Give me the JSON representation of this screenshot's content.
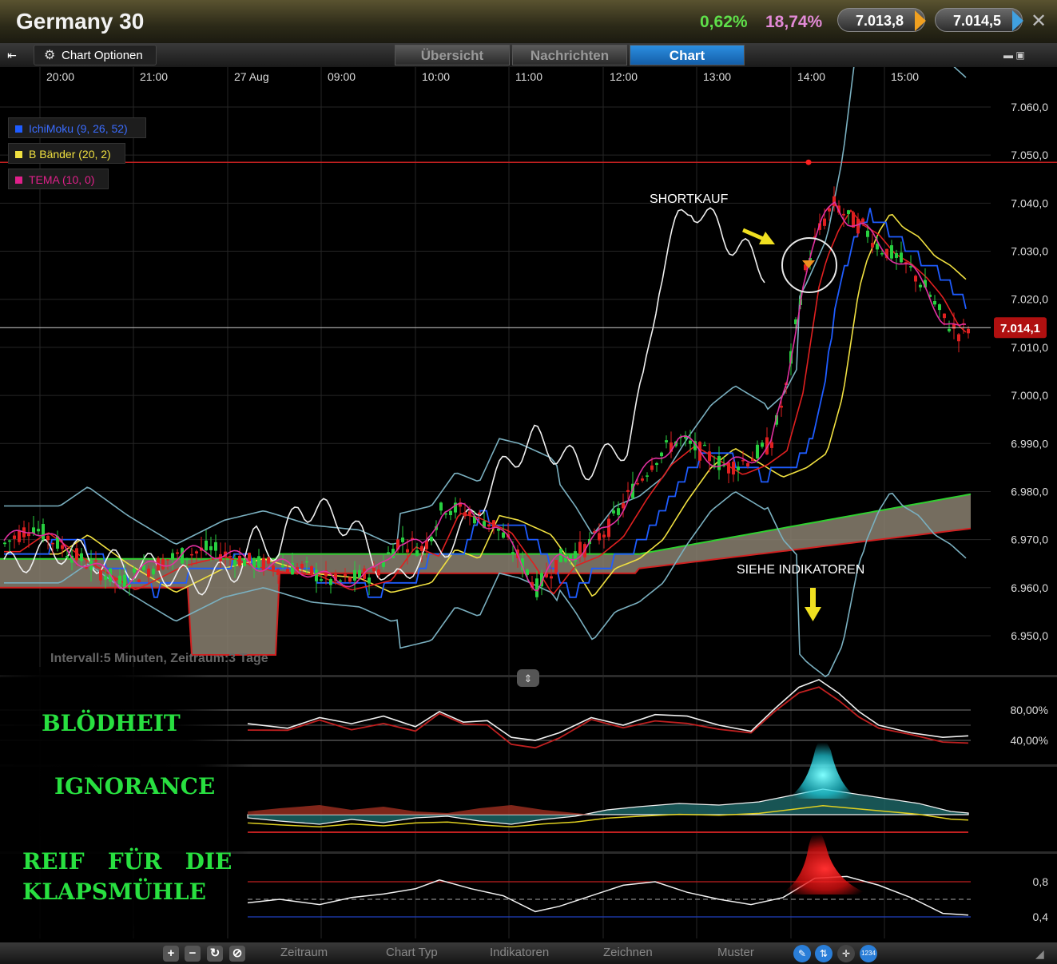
{
  "header": {
    "title": "Germany 30",
    "change_pct": "0,62%",
    "range_pct": "18,74%",
    "sell": "7.013,8",
    "buy": "7.014,5"
  },
  "toolbar": {
    "chart_options": "Chart Optionen",
    "tabs": [
      {
        "label": "Übersicht",
        "active": false
      },
      {
        "label": "Nachrichten",
        "active": false
      },
      {
        "label": "Chart",
        "active": true
      }
    ]
  },
  "legend": [
    {
      "label": "IchiMoku (9, 26, 52)",
      "color": "#1e5cff"
    },
    {
      "label": "B Bänder (20, 2)",
      "color": "#f0e040"
    },
    {
      "label": "TEMA (10, 0)",
      "color": "#e0208a"
    }
  ],
  "annotations": {
    "shortkauf": "SHORTKAUF",
    "siehe": "SIEHE INDIKATOREN",
    "interval": "Intervall:5 Minuten, Zeitraum:3 Tage",
    "note1": "BLÖDHEIT",
    "note2": "IGNORANCE",
    "note3a": "REIF   FÜR   DIE",
    "note3b": "KLAPSMÜHLE"
  },
  "bottombar": {
    "menus": [
      "Zeitraum",
      "Chart Typ",
      "Indikatoren",
      "Zeichnen",
      "Muster"
    ],
    "badge": "1234"
  },
  "chart_data": [
    {
      "type": "candlestick",
      "x_ticks": [
        "20:00",
        "21:00",
        "27 Aug",
        "09:00",
        "10:00",
        "11:00",
        "12:00",
        "13:00",
        "14:00",
        "15:00"
      ],
      "y_ticks": [
        "7.060,0",
        "7.050,0",
        "7.040,0",
        "7.030,0",
        "7.020,0",
        "7.010,0",
        "7.000,0",
        "6.990,0",
        "6.980,0",
        "6.970,0",
        "6.960,0",
        "6.950,0"
      ],
      "ylim": [
        6944,
        7066
      ],
      "current_price": "7.014,1",
      "current_value": 7014.1,
      "resistance_level": 7048.5,
      "series": [
        {
          "name": "IchiMoku (9, 26, 52)",
          "color": "#1e5cff"
        },
        {
          "name": "B Bänder (20, 2)",
          "color": "#f0e040"
        },
        {
          "name": "TEMA (10, 0)",
          "color": "#e0208a"
        }
      ]
    },
    {
      "type": "line",
      "y_ticks": [
        "80,00%",
        "40,00%"
      ]
    },
    {
      "type": "area"
    },
    {
      "type": "line",
      "y_ticks": [
        "0,8",
        "0,4"
      ]
    }
  ],
  "colors": {
    "bull": "#28d040",
    "bear": "#e02020",
    "cloud": "#8a8070",
    "accent": "#2c8ee0"
  }
}
